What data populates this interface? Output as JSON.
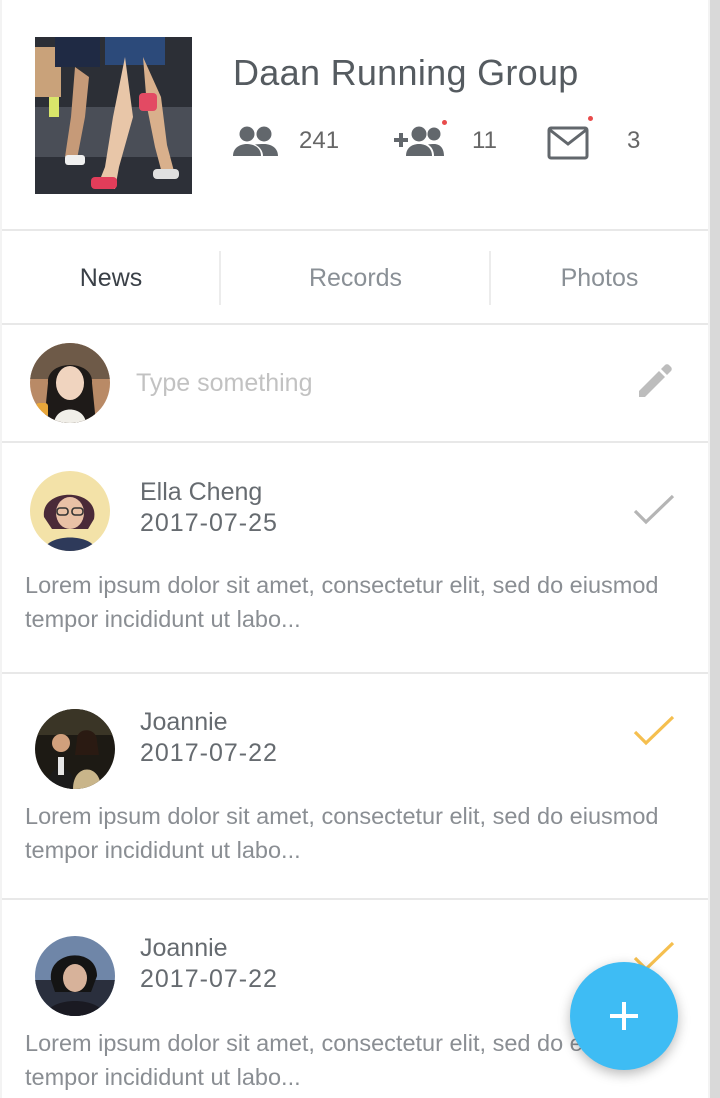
{
  "group": {
    "name": "Daan Running Group",
    "members_count": "241",
    "requests_count": "11",
    "messages_count": "3"
  },
  "tabs": [
    {
      "label": "News",
      "active": true
    },
    {
      "label": "Records",
      "active": false
    },
    {
      "label": "Photos",
      "active": false
    }
  ],
  "compose": {
    "placeholder": "Type something"
  },
  "posts": [
    {
      "author": "Ella Cheng",
      "date": "2017-07-25",
      "body": "Lorem ipsum dolor sit amet, consectetur elit, sed do eiusmod tempor incididunt ut labo...",
      "checked": false
    },
    {
      "author": "Joannie",
      "date": "2017-07-22",
      "body": "Lorem ipsum dolor sit amet, consectetur elit, sed do eiusmod tempor incididunt ut labo...",
      "checked": true
    },
    {
      "author": "Joannie",
      "date": "2017-07-22",
      "body": "Lorem ipsum dolor sit amet, consectetur elit, sed do eiusmod tempor incididunt ut labo...",
      "checked": true
    }
  ],
  "colors": {
    "accent": "#3ebcf4",
    "checked": "#f5bf4f",
    "unchecked": "#b5b5b5",
    "badge_dot": "#e84b4b"
  }
}
